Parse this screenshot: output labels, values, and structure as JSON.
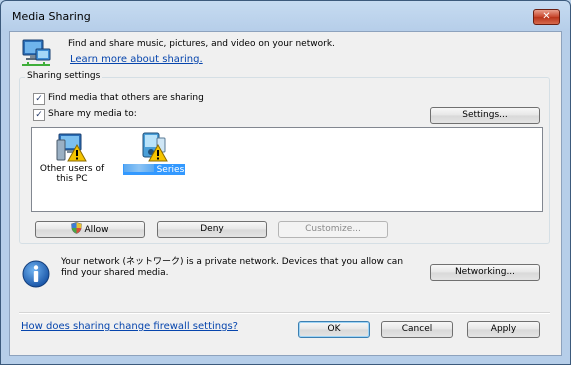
{
  "window": {
    "title": "Media Sharing",
    "close_glyph": "✕"
  },
  "header": {
    "icon": "media-sharing-network-icon",
    "text": "Find and share music, pictures, and video on your network.",
    "link": "Learn more about sharing."
  },
  "sharing_settings": {
    "label": "Sharing settings",
    "find_media_label": "Find media that others are sharing",
    "find_media_checked": true,
    "share_media_label": "Share my media to:",
    "share_media_checked": true,
    "check_glyph": "✓",
    "settings_button": "Settings...",
    "devices": [
      {
        "name_line1": "Other users of",
        "name_line2": "this PC",
        "icon": "computer-warning-icon",
        "selected": false
      },
      {
        "name_line1": "Series",
        "name_line2": "",
        "icon": "media-device-warning-icon",
        "selected": true
      }
    ],
    "allow_button": "Allow",
    "deny_button": "Deny",
    "customize_button": "Customize..."
  },
  "network_info": {
    "icon": "info-icon",
    "line1": "Your network (ネットワーク) is a private network. Devices that you allow can",
    "line2": "find your shared media.",
    "networking_button": "Networking..."
  },
  "footer": {
    "help_link": "How does sharing change firewall settings?",
    "ok_button": "OK",
    "cancel_button": "Cancel",
    "apply_button": "Apply"
  },
  "colors": {
    "accent": "#3399ff",
    "link": "#0645ad",
    "warning": "#f5c400"
  }
}
